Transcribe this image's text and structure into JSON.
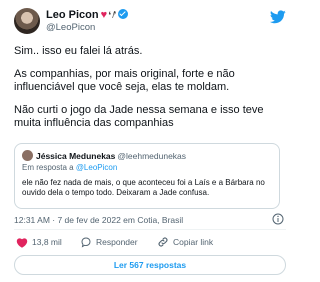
{
  "author": {
    "name": "Leo Picon",
    "heart": "♥",
    "deco": "❛ ̸❜",
    "handle": "@LeoPicon"
  },
  "tweet": {
    "paragraphs": [
      "Sim.. isso eu falei lá atrás.",
      "As companhias, por mais original, forte e não influenciável que você seja, elas te moldam.",
      "Não curti o jogo da Jade nessa semana e isso teve muita influência das companhias"
    ]
  },
  "quoted": {
    "name": "Jéssica Medunekas",
    "handle": "@leehmedunekas",
    "reply_prefix": "Em resposta a",
    "reply_to": "@LeoPicon",
    "text": "ele   não fez nada de mais, o que aconteceu foi a Laís e a Bárbara no ouvido dela o tempo todo. Deixaram a Jade confusa."
  },
  "meta": {
    "time_date": "12:31 AM · 7 de fev de 2022 em Cotia, Brasil"
  },
  "actions": {
    "likes": "13,8 mil",
    "reply_label": "Responder",
    "copy_label": "Copiar link"
  },
  "read_replies": "Ler 567 respostas",
  "colors": {
    "accent": "#1d9bf0",
    "like": "#e0245e",
    "muted": "#536471"
  }
}
